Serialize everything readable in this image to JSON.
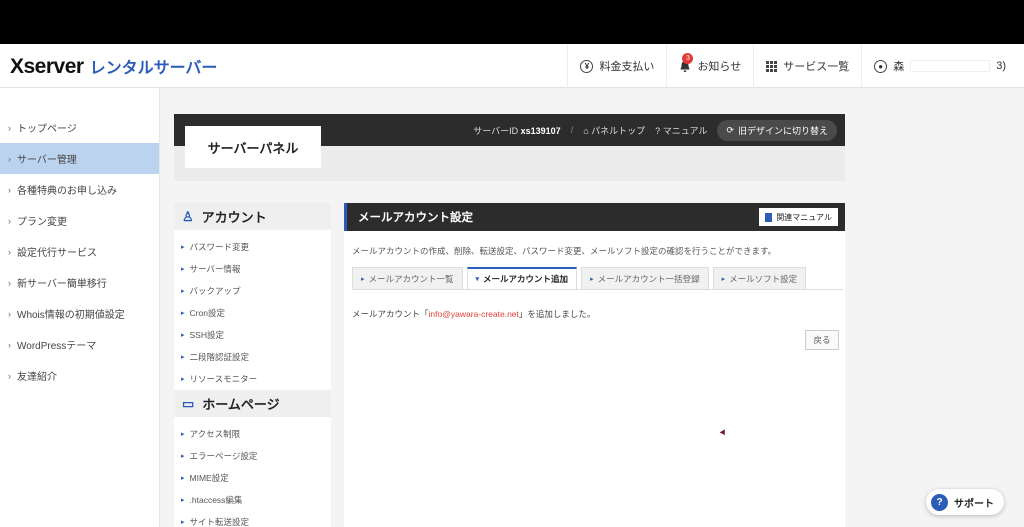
{
  "header": {
    "logo_main": "Xserver",
    "logo_sub": "レンタルサーバー",
    "nav": [
      {
        "label": "料金支払い",
        "icon": "yen-circle-icon"
      },
      {
        "label": "お知らせ",
        "icon": "bell-icon",
        "badge": "3"
      },
      {
        "label": "サービス一覧",
        "icon": "grid-icon"
      },
      {
        "label": "森",
        "icon": "user-icon",
        "suffix": "3)"
      }
    ]
  },
  "sidebar": {
    "items": [
      {
        "label": "トップページ",
        "active": false
      },
      {
        "label": "サーバー管理",
        "active": true
      },
      {
        "label": "各種特典のお申し込み",
        "active": false
      },
      {
        "label": "プラン変更",
        "active": false
      },
      {
        "label": "設定代行サービス",
        "active": false
      },
      {
        "label": "新サーバー簡単移行",
        "active": false
      },
      {
        "label": "Whois情報の初期値設定",
        "active": false
      },
      {
        "label": "WordPressテーマ",
        "active": false
      },
      {
        "label": "友達紹介",
        "active": false
      }
    ]
  },
  "panel": {
    "title": "サーバーパネル",
    "server_id_label": "サーバーID",
    "server_id": "xs139107",
    "panel_top": "パネルトップ",
    "manual": "マニュアル",
    "old_design": "旧デザインに切り替え"
  },
  "subnav": {
    "account_heading": "アカウント",
    "account_items": [
      "パスワード変更",
      "サーバー情報",
      "バックアップ",
      "Cron設定",
      "SSH設定",
      "二段階認証設定",
      "リソースモニター"
    ],
    "home_heading": "ホームページ",
    "home_items": [
      "アクセス制限",
      "エラーページ設定",
      "MIME設定",
      ".htaccess編集",
      "サイト転送設定"
    ]
  },
  "content": {
    "title": "メールアカウント設定",
    "manual_button": "関連マニュアル",
    "description": "メールアカウントの作成、削除、転送設定、パスワード変更、メールソフト設定の確認を行うことができます。",
    "tabs": [
      {
        "label": "メールアカウント一覧",
        "active": false
      },
      {
        "label": "メールアカウント追加",
        "active": true
      },
      {
        "label": "メールアカウント一括登録",
        "active": false
      },
      {
        "label": "メールソフト設定",
        "active": false
      }
    ],
    "result_prefix": "メールアカウント「",
    "result_email": "info@yawara-create.net",
    "result_suffix": "」を追加しました。",
    "back_button": "戻る"
  },
  "support": {
    "label": "サポート"
  },
  "colors": {
    "accent": "#2b5cb8",
    "active_bg": "#bcd3ef",
    "dark_bar": "#2c2c2c",
    "email_red": "#e0433c"
  }
}
